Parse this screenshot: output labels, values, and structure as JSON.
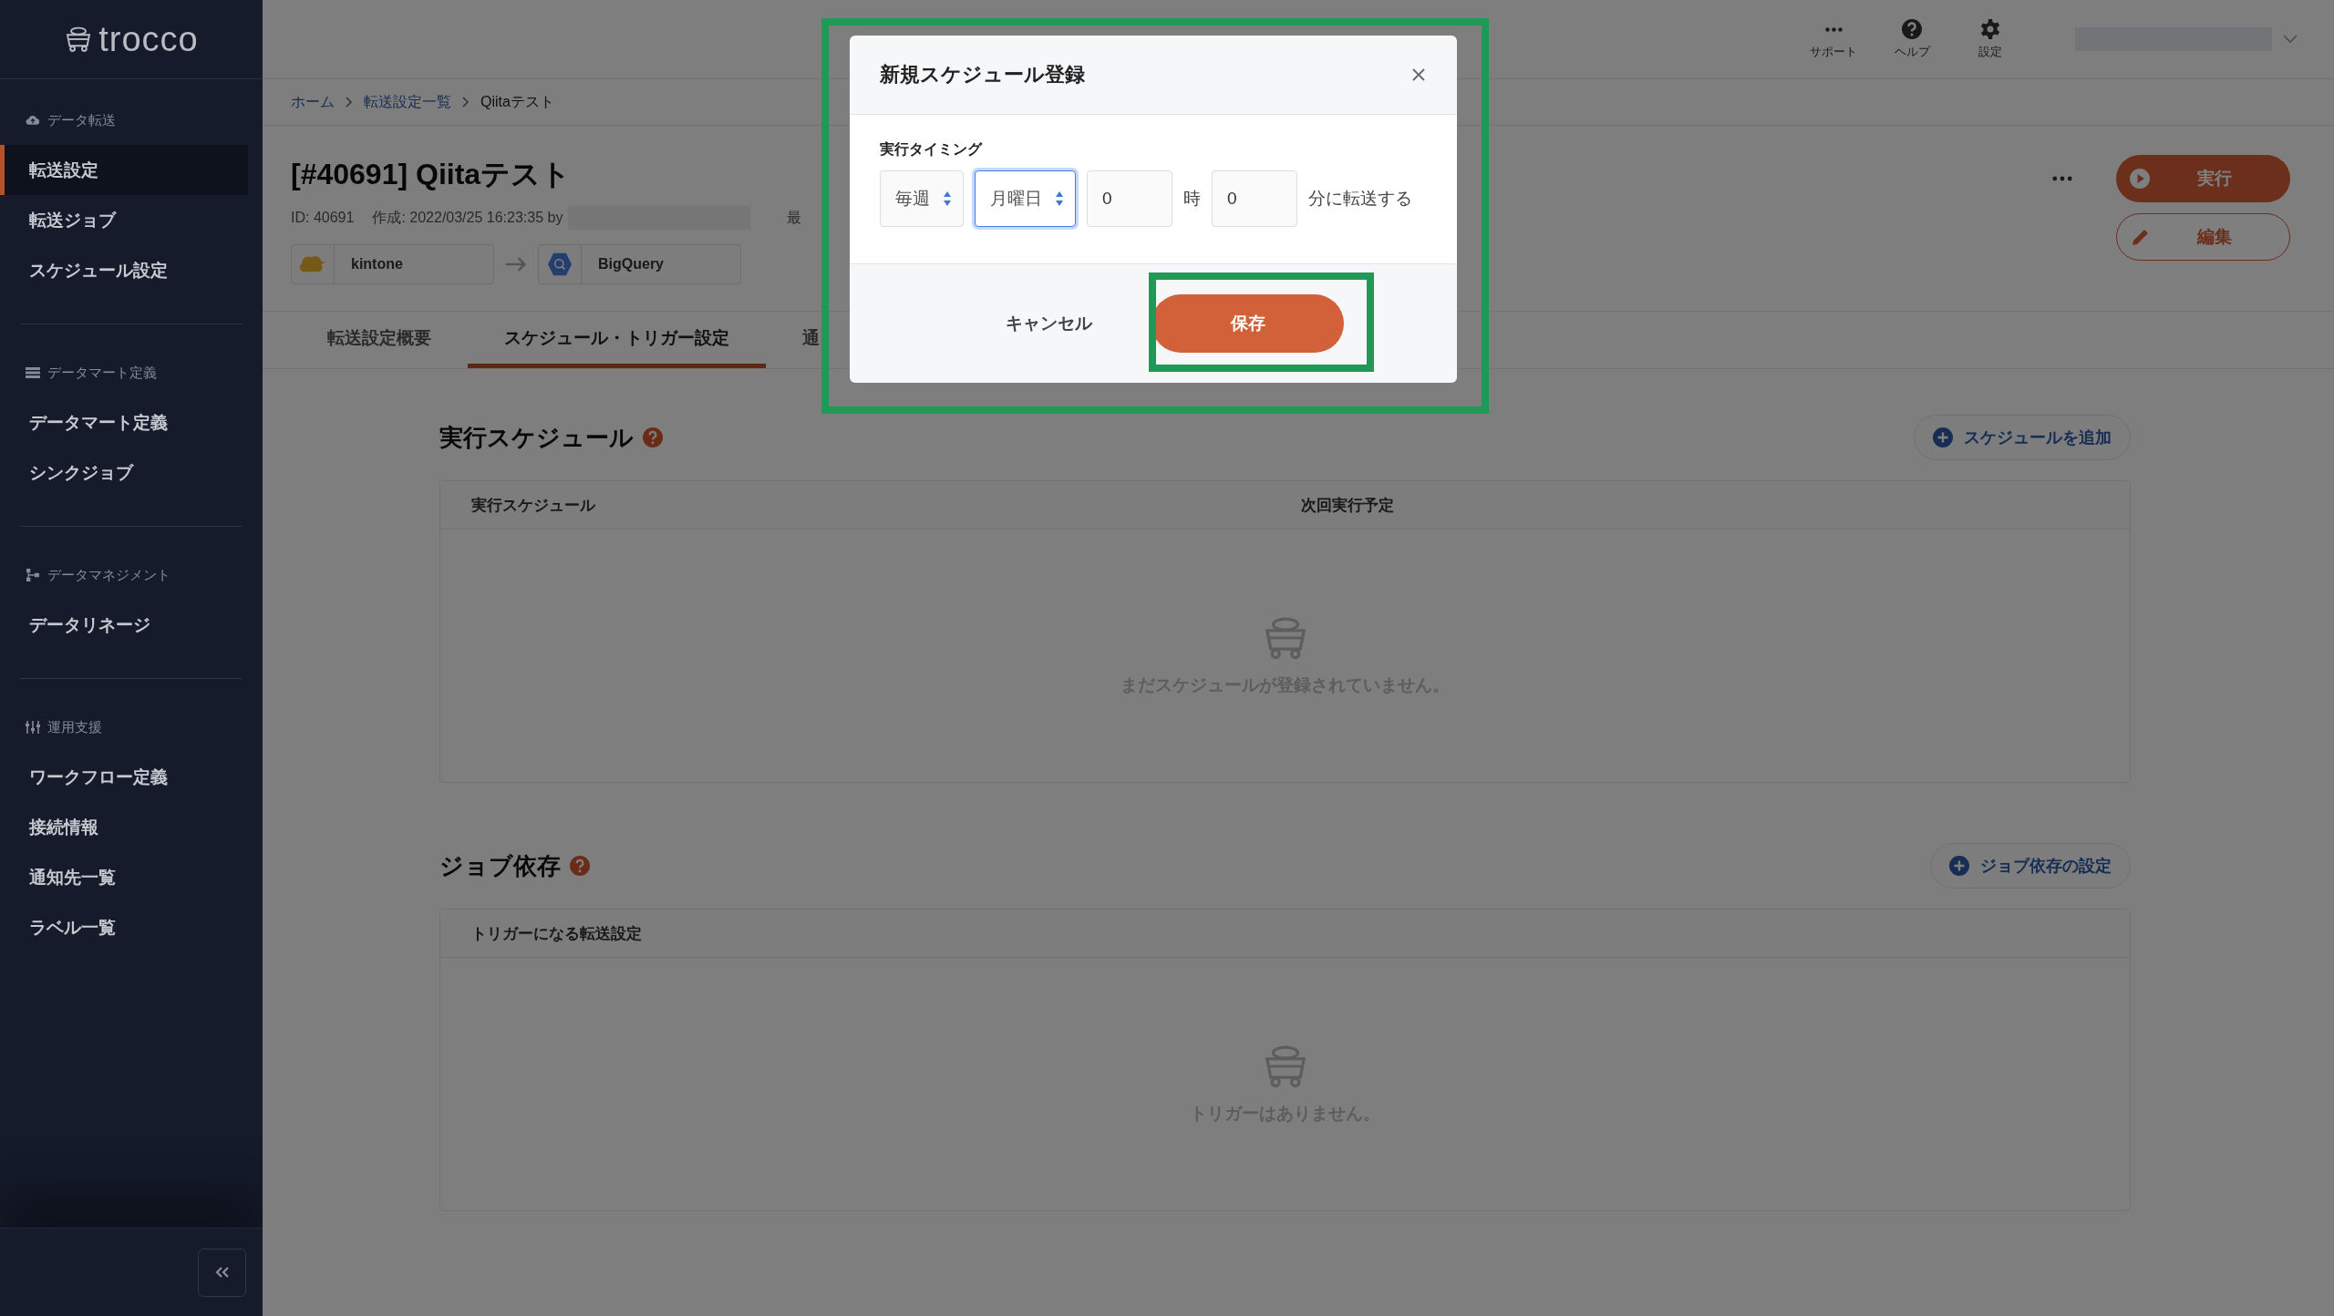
{
  "sidebar": {
    "logo": "trocco",
    "sections": [
      {
        "heading": "データ転送",
        "items": [
          {
            "label": "転送設定",
            "selected": true
          },
          {
            "label": "転送ジョブ",
            "selected": false
          },
          {
            "label": "スケジュール設定",
            "selected": false
          }
        ]
      },
      {
        "heading": "データマート定義",
        "items": [
          {
            "label": "データマート定義",
            "selected": false
          },
          {
            "label": "シンクジョブ",
            "selected": false
          }
        ]
      },
      {
        "heading": "データマネジメント",
        "items": [
          {
            "label": "データリネージ",
            "selected": false
          }
        ]
      },
      {
        "heading": "運用支援",
        "items": [
          {
            "label": "ワークフロー定義",
            "selected": false
          },
          {
            "label": "接続情報",
            "selected": false
          },
          {
            "label": "通知先一覧",
            "selected": false
          },
          {
            "label": "ラベル一覧",
            "selected": false
          }
        ]
      }
    ]
  },
  "topbar": {
    "items": [
      {
        "label": "サポート"
      },
      {
        "label": "ヘルプ"
      },
      {
        "label": "設定"
      }
    ]
  },
  "breadcrumb": [
    {
      "label": "ホーム",
      "link": true
    },
    {
      "label": "転送設定一覧",
      "link": true
    },
    {
      "label": "Qiitaテスト",
      "link": false
    }
  ],
  "job": {
    "title": "[#40691] Qiitaテスト",
    "id": "ID: 40691",
    "created": "作成: 2022/03/25 16:23:35 by",
    "updated": "最",
    "source": "kintone",
    "destination": "BigQuery",
    "run_button": "実行",
    "edit_button": "編集"
  },
  "tabs": [
    {
      "label": "転送設定概要",
      "selected": false
    },
    {
      "label": "スケジュール・トリガー設定",
      "selected": true
    },
    {
      "label": "通",
      "selected": false
    }
  ],
  "sections": [
    {
      "title": "実行スケジュール",
      "action": "スケジュールを追加",
      "columns": [
        "実行スケジュール",
        "次回実行予定"
      ],
      "empty": "まだスケジュールが登録されていません。"
    },
    {
      "title": "ジョブ依存",
      "action": "ジョブ依存の設定",
      "columns": [
        "トリガーになる転送設定"
      ],
      "empty": "トリガーはありません。"
    }
  ],
  "modal": {
    "title": "新規スケジュール登録",
    "field_label": "実行タイミング",
    "frequency": {
      "value": "毎週",
      "focused": false
    },
    "weekday": {
      "value": "月曜日",
      "focused": true
    },
    "hour": "0",
    "hour_unit": "時",
    "minute": "0",
    "suffix": "分に転送する",
    "cancel_button": "キャンセル",
    "save_button": "保存"
  }
}
